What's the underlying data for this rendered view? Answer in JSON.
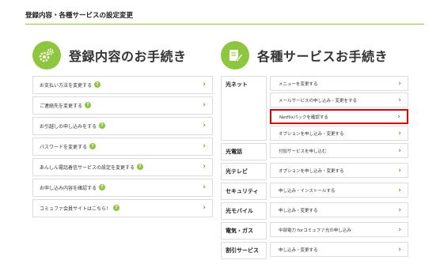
{
  "page_title": "登録内容・各種サービスの設定変更",
  "left_section": {
    "title": "登録内容のお手続き",
    "items": [
      {
        "label": "お支払い方法を変更する"
      },
      {
        "label": "ご連絡先を変更する"
      },
      {
        "label": "お引越しの申し込みをする"
      },
      {
        "label": "パスワードを変更する"
      },
      {
        "label": "あんしん電話着信サービスの設定を変更する"
      },
      {
        "label": "お申し込み内容を確認する"
      },
      {
        "label": "コミュファ会員サイトはこちら！"
      }
    ]
  },
  "right_section": {
    "title": "各種サービスお手続き",
    "categories": [
      {
        "name": "光ネット",
        "items": [
          "メニューを変更する",
          "メールサービスの申し込み・変更をする",
          "Netflixパックを確認する",
          "オプションを申し込み・変更する"
        ]
      },
      {
        "name": "光電話",
        "items": [
          "付加サービスを申し込む"
        ]
      },
      {
        "name": "光テレビ",
        "items": [
          "オプションを申し込み・変更する"
        ]
      },
      {
        "name": "セキュリティ",
        "items": [
          "申し込み・インストールする"
        ]
      },
      {
        "name": "光モバイル",
        "items": [
          "申し込み・変更する"
        ]
      },
      {
        "name": "電気・ガス",
        "items": [
          "中部電力 forコミュファ光の申し込み"
        ]
      },
      {
        "name": "割引サービス",
        "items": [
          "申し込み・変更する"
        ]
      }
    ]
  },
  "help_glyph": "?",
  "chevron_glyph": "›",
  "accent_color": "#8ec63f",
  "highlight_color": "#e00000",
  "highlighted_item": "Netflixパックを確認する"
}
